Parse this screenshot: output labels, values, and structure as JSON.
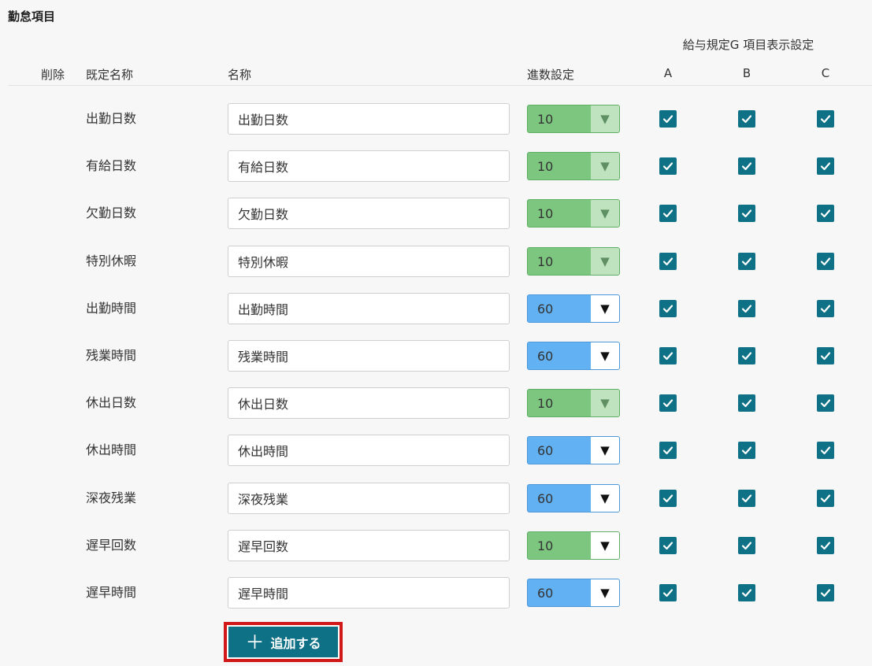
{
  "section": {
    "title": "勤怠項目"
  },
  "header": {
    "group_label": "給与規定G 項目表示設定",
    "delete": "削除",
    "default_name": "既定名称",
    "name": "名称",
    "rounding": "進数設定",
    "col_a": "A",
    "col_b": "B",
    "col_c": "C"
  },
  "rows": [
    {
      "default_name": "出勤日数",
      "name": "出勤日数",
      "rounding": "10",
      "a": true,
      "b": true,
      "c": true
    },
    {
      "default_name": "有給日数",
      "name": "有給日数",
      "rounding": "10",
      "a": true,
      "b": true,
      "c": true
    },
    {
      "default_name": "欠勤日数",
      "name": "欠勤日数",
      "rounding": "10",
      "a": true,
      "b": true,
      "c": true
    },
    {
      "default_name": "特別休暇",
      "name": "特別休暇",
      "rounding": "10",
      "a": true,
      "b": true,
      "c": true
    },
    {
      "default_name": "出勤時間",
      "name": "出勤時間",
      "rounding": "60",
      "a": true,
      "b": true,
      "c": true
    },
    {
      "default_name": "残業時間",
      "name": "残業時間",
      "rounding": "60",
      "a": true,
      "b": true,
      "c": true
    },
    {
      "default_name": "休出日数",
      "name": "休出日数",
      "rounding": "10",
      "a": true,
      "b": true,
      "c": true
    },
    {
      "default_name": "休出時間",
      "name": "休出時間",
      "rounding": "60",
      "a": true,
      "b": true,
      "c": true
    },
    {
      "default_name": "深夜残業",
      "name": "深夜残業",
      "rounding": "60",
      "a": true,
      "b": true,
      "c": true
    },
    {
      "default_name": "遅早回数",
      "name": "遅早回数",
      "rounding": "10",
      "a": true,
      "b": true,
      "c": true
    },
    {
      "default_name": "遅早時間",
      "name": "遅早時間",
      "rounding": "60",
      "a": true,
      "b": true,
      "c": true
    }
  ],
  "add_button": {
    "label": "追加する",
    "icon": "plus-icon"
  },
  "colors": {
    "accent": "#0e7186",
    "select_green": "#7dc67f",
    "select_blue": "#62b1f3",
    "highlight": "#d21919"
  }
}
